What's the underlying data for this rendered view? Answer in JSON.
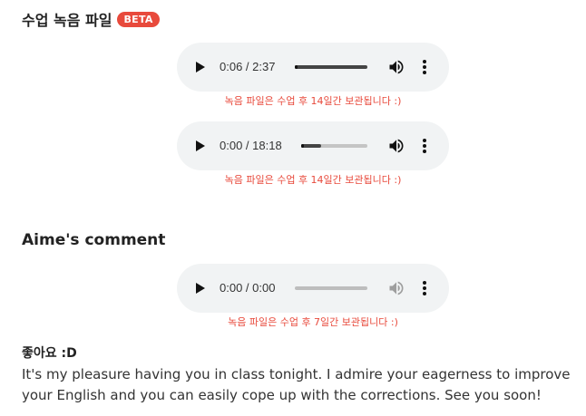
{
  "recordings_section": {
    "title": "수업 녹음 파일",
    "badge": "BETA"
  },
  "players": [
    {
      "time": "0:06 / 2:37",
      "progress": 0.04,
      "note": "녹음 파일은 수업 후 14일간 보관됩니다 :)",
      "muted_style": false
    },
    {
      "time": "0:00 / 18:18",
      "progress": 0.0,
      "buffered": 0.3,
      "note": "녹음 파일은 수업 후 14일간 보관됩니다 :)",
      "muted_style": false
    },
    {
      "time": "0:00 / 0:00",
      "progress": 0.0,
      "note": "녹음 파일은 수업 후 7일간 보관됩니다 :)",
      "muted_style": true
    }
  ],
  "comment_section": {
    "title": "Aime's comment",
    "label": "좋아요 :D",
    "body": "It's my pleasure having you in class tonight. I admire your eagerness to improve your English and you can easily cope up with the corrections. See you soon!"
  },
  "colors": {
    "accent": "#e84a3c",
    "player_bg": "#f1f3f4"
  },
  "icons": [
    "play-icon",
    "volume-icon",
    "more-vert-icon"
  ]
}
